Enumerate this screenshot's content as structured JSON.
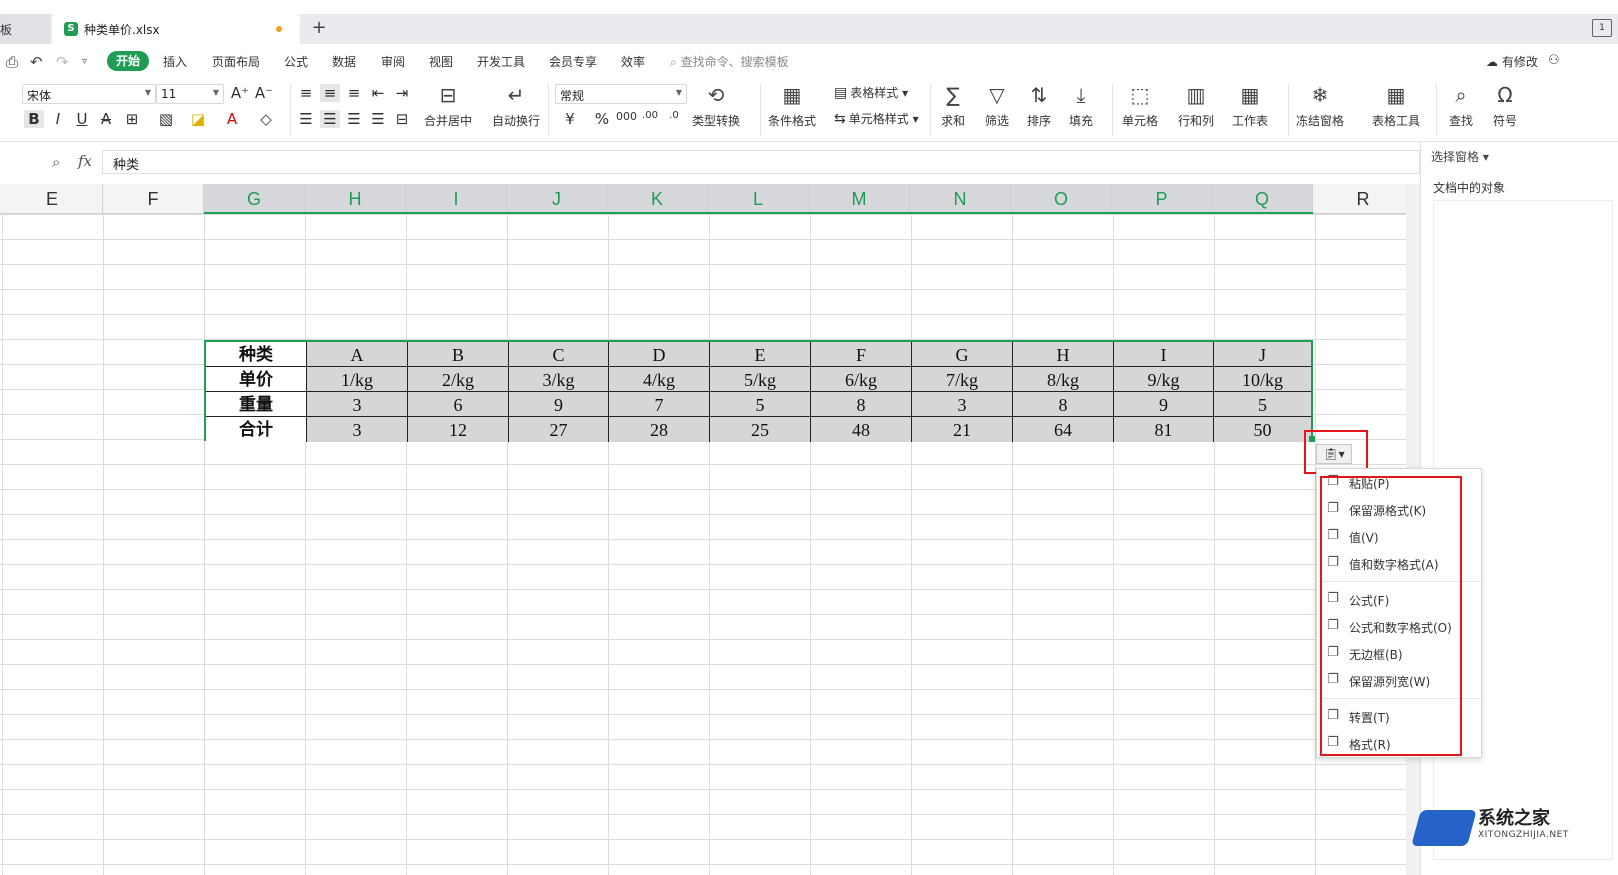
{
  "tabs": {
    "prev_tab_label": "模板",
    "active_tab_label": "种类单价.xlsx",
    "doc_icon_letter": "S",
    "add_tab": "+",
    "window_icon": "1"
  },
  "menu": {
    "items": [
      "开始",
      "插入",
      "页面布局",
      "公式",
      "数据",
      "审阅",
      "视图",
      "开发工具",
      "会员专享",
      "效率"
    ],
    "search_placeholder": "查找命令、搜索模板",
    "modified_label": "有修改"
  },
  "ribbon": {
    "font_name": "宋体",
    "font_size": "11",
    "number_format": "常规",
    "merge_label": "合并居中",
    "wrap_label": "自动换行",
    "type_convert_label": "类型转换",
    "cond_format_label": "条件格式",
    "table_style_label": "表格样式",
    "cell_style_label": "单元格样式",
    "sum_label": "求和",
    "filter_label": "筛选",
    "sort_label": "排序",
    "fill_label": "填充",
    "cell_label": "单元格",
    "rowcol_label": "行和列",
    "sheet_label": "工作表",
    "freeze_label": "冻结窗格",
    "table_tools_label": "表格工具",
    "find_label": "查找",
    "symbol_label": "符号"
  },
  "formula_bar": {
    "fx": "fx",
    "value": "种类"
  },
  "columns": [
    "E",
    "F",
    "G",
    "H",
    "I",
    "J",
    "K",
    "L",
    "M",
    "N",
    "O",
    "P",
    "Q",
    "R"
  ],
  "table": {
    "rows": [
      [
        "种类",
        "A",
        "B",
        "C",
        "D",
        "E",
        "F",
        "G",
        "H",
        "I",
        "J"
      ],
      [
        "单价",
        "1/kg",
        "2/kg",
        "3/kg",
        "4/kg",
        "5/kg",
        "6/kg",
        "7/kg",
        "8/kg",
        "9/kg",
        "10/kg"
      ],
      [
        "重量",
        "3",
        "6",
        "9",
        "7",
        "5",
        "8",
        "3",
        "8",
        "9",
        "5"
      ],
      [
        "合计",
        "3",
        "12",
        "27",
        "28",
        "25",
        "48",
        "21",
        "64",
        "81",
        "50"
      ]
    ]
  },
  "right_pane": {
    "title": "选择窗格",
    "subtitle": "文档中的对象"
  },
  "paste_menu": {
    "trigger_caret": "▾",
    "items": [
      "粘贴(P)",
      "保留源格式(K)",
      "值(V)",
      "值和数字格式(A)",
      "公式(F)",
      "公式和数字格式(O)",
      "无边框(B)",
      "保留源列宽(W)",
      "转置(T)",
      "格式(R)"
    ]
  },
  "watermark": {
    "name": "系统之家",
    "url": "XITONGZHIJIA.NET"
  },
  "colors": {
    "accent": "#1f9d55",
    "highlight_red": "#e8141b",
    "cell_grey": "#d6d6d6"
  }
}
